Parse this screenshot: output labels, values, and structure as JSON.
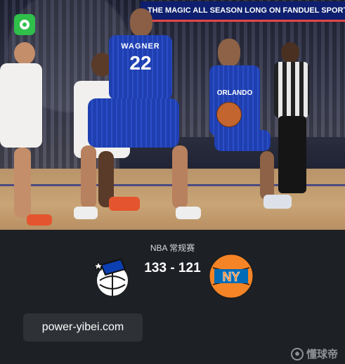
{
  "photo": {
    "banner_text": "THE MAGIC ALL SEASON LONG ON FANDUEL SPORTS NETWORK",
    "jersey_name": "WAGNER",
    "jersey_number": "22",
    "jersey_team": "ORLANDO"
  },
  "game": {
    "league": "NBA 常规赛",
    "score": "133 - 121",
    "home_logo_icon": "orlando-magic-logo-icon",
    "away_logo_text": "NY"
  },
  "overlay": {
    "url": "power-yibei.com",
    "watermark": "懂球帝"
  },
  "colors": {
    "app_icon": "#2fbf4a",
    "panel_bg": "#1d2024",
    "knicks_orange": "#f58426",
    "knicks_blue": "#006bb6"
  }
}
